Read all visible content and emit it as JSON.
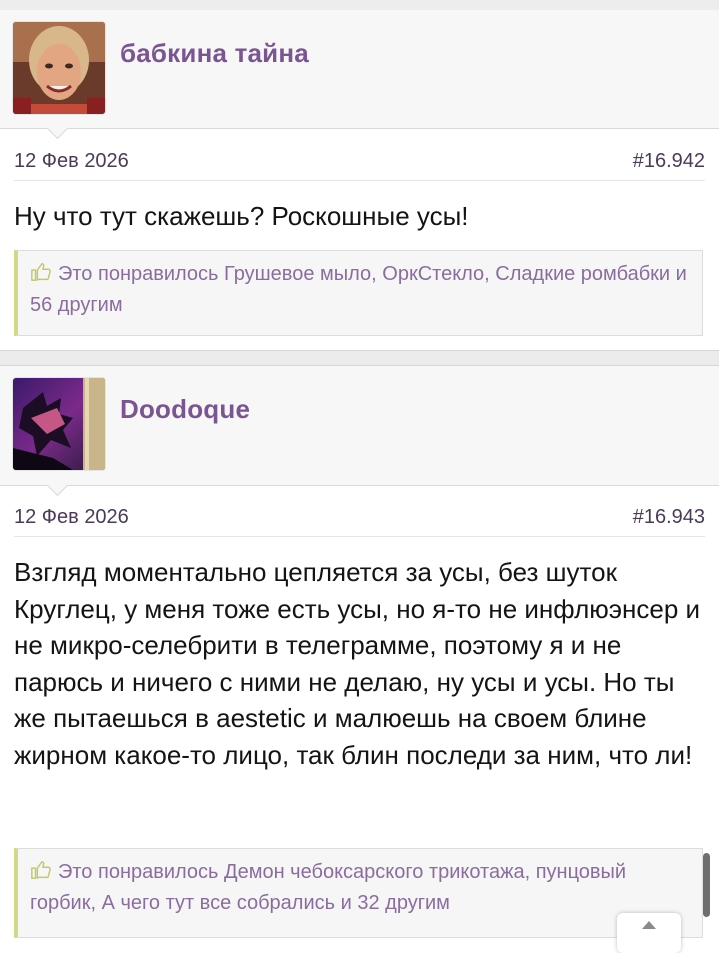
{
  "posts": [
    {
      "username": "бабкина тайна",
      "date": "12 Фев 2026",
      "post_number": "#16.942",
      "message": "Ну что тут скажешь? Роскошные усы!",
      "likes_text": "Это понравилось Грушевое мыло, ОркСтекло, Сладкие ромбабки и 56 другим"
    },
    {
      "username": "Doodoque",
      "date": "12 Фев 2026",
      "post_number": "#16.943",
      "message": "Взгляд моментально цепляется за усы, без шуток Круглец, у меня тоже есть усы, но я-то не инфлюэнсер и не микро-селебрити в телеграмме, поэтому я и не парюсь и ничего с ними не делаю, ну усы и усы. Но ты же пытаешься в aestetic и малюешь на своем блине жирном какое-то лицо, так блин последи за ним, что ли!",
      "likes_text": "Это понравилось Демон чебоксарского трикотажа, пунцовый горбик, А чего тут все собрались и 32 другим"
    }
  ],
  "colors": {
    "username": "#7b5592",
    "likes_text": "#8a6d9e",
    "likes_border": "#d2d887",
    "background": "#ffffff"
  },
  "icons": {
    "like": "thumbs-up-icon",
    "scroll": "chevron-up-icon"
  }
}
